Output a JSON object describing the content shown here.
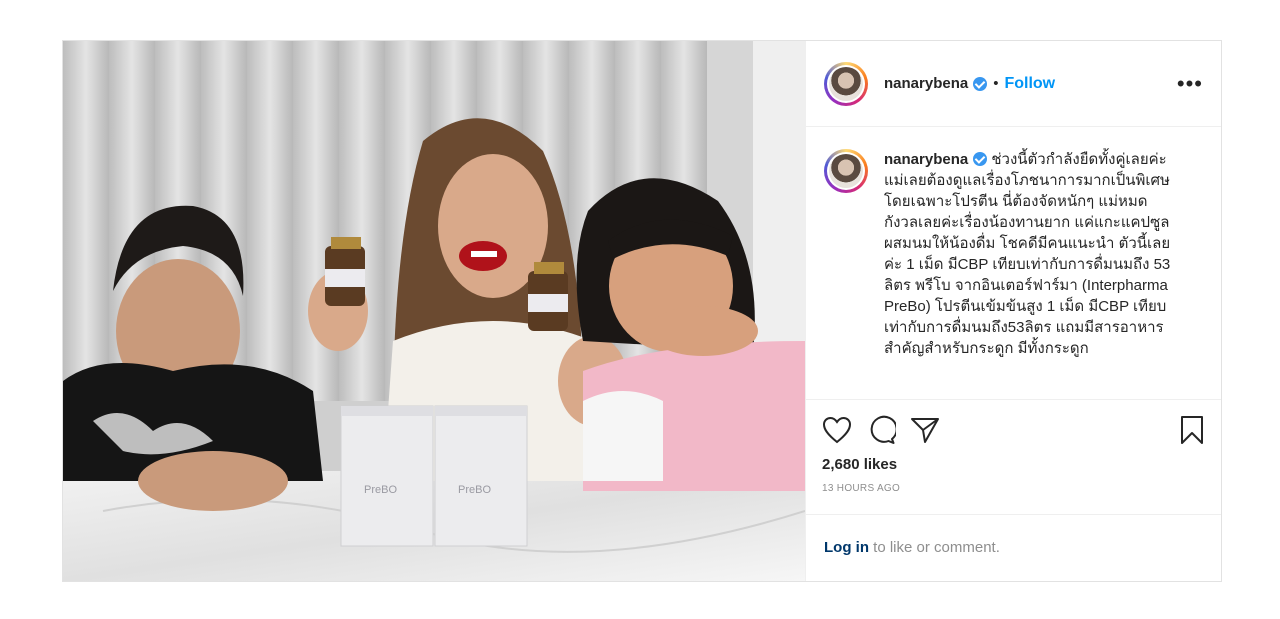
{
  "post": {
    "username": "nanarybena",
    "dot": "•",
    "follow_label": "Follow",
    "more_label": "•••",
    "caption_username": "nanarybena",
    "caption": "ช่วงนี้ตัวกำลังยืดทั้งคู่เลยค่ะ แม่เลยต้องดูแลเรื่องโภชนาการมากเป็นพิเศษ โดยเฉพาะโปรตีน นี่ต้องจัดหนักๆ แม่หมดกังวลเลยค่ะเรื่องน้องทานยาก แค่แกะแคปซูลผสมนมให้น้องดื่ม โชคดีมีคนแนะนำ ตัวนี้เลยค่ะ 1 เม็ด มีCBP เทียบเท่ากับการดื่มนมถึง 53 ลิตร พรีโบ จากอินเตอร์ฟาร์มา (Interpharma PreBo) โปรตีนเข้มข้นสูง 1 เม็ด มีCBP เทียบเท่ากับการดื่มนมถึง53ลิตร แถมมีสารอาหารสำคัญสำหรับกระดูก มีทั้งกระดูก",
    "likes": "2,680 likes",
    "time_ago": "13 HOURS AGO",
    "login_link": "Log in",
    "login_rest": " to like or comment.",
    "product_brand": "Interpharma",
    "product_name": "PreBO",
    "icons": [
      "heart-icon",
      "comment-icon",
      "share-icon",
      "bookmark-icon",
      "verified-badge-icon"
    ],
    "colors": {
      "follow": "#0095f6",
      "verified": "#3897f0",
      "muted": "#8e8e8e"
    }
  }
}
